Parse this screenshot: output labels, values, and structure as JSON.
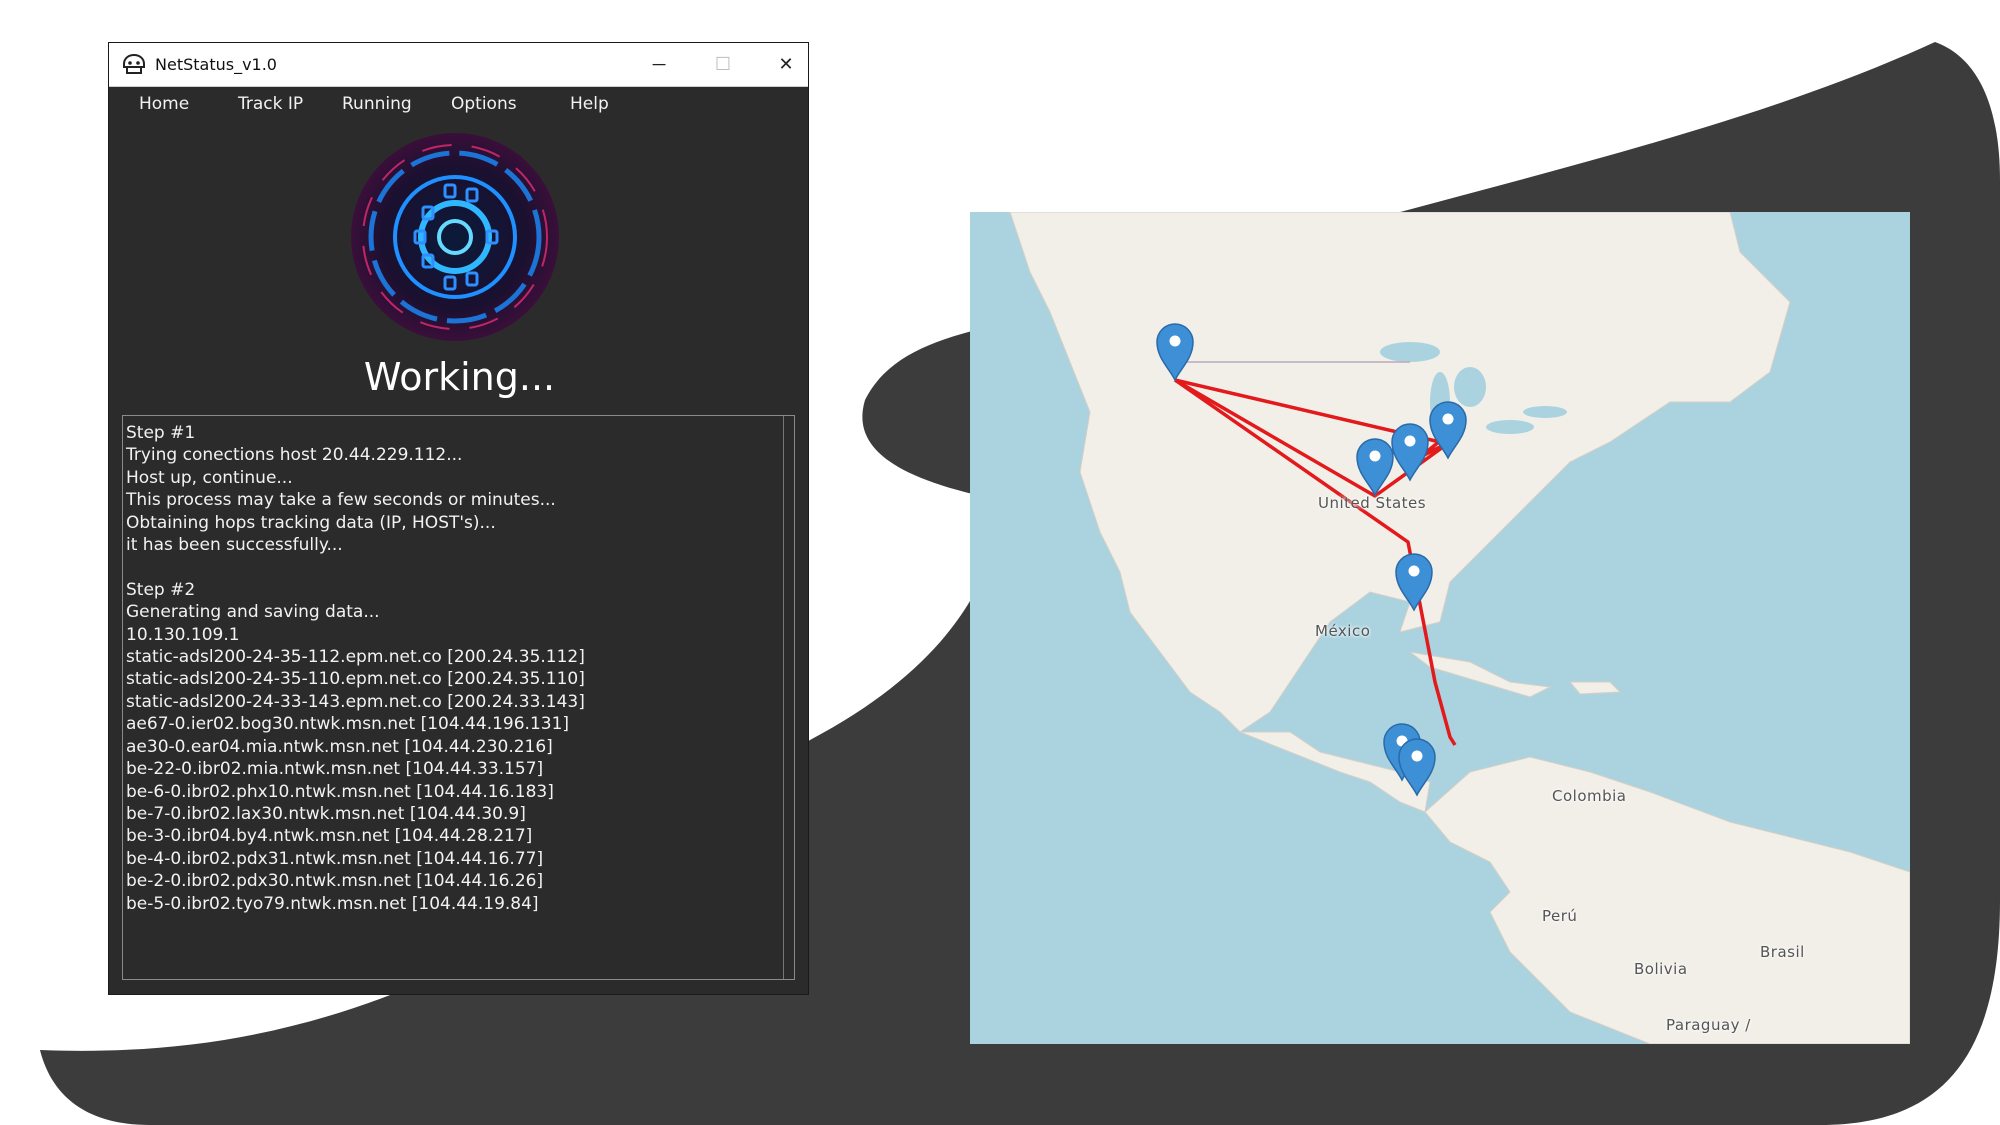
{
  "window": {
    "title": "NetStatus_v1.0",
    "minimize_glyph": "─",
    "maximize_glyph": "☐",
    "close_glyph": "✕"
  },
  "menu": [
    "Home",
    "Track IP",
    "Running",
    "Options",
    "Help"
  ],
  "status_text": "Working...",
  "log": {
    "step1": {
      "title": "Step #1",
      "lines": [
        "Trying conections host 20.44.229.112...",
        "Host up, continue...",
        "This process may take a few seconds or minutes...",
        "Obtaining hops tracking data (IP, HOST's)...",
        "it has been successfully..."
      ]
    },
    "step2": {
      "title": "Step #2",
      "lines": [
        "Generating and saving data...",
        "10.130.109.1",
        "static-adsl200-24-35-112.epm.net.co [200.24.35.112]",
        "static-adsl200-24-35-110.epm.net.co [200.24.35.110]",
        "static-adsl200-24-33-143.epm.net.co [200.24.33.143]",
        "ae67-0.ier02.bog30.ntwk.msn.net [104.44.196.131]",
        "ae30-0.ear04.mia.ntwk.msn.net [104.44.230.216]",
        "be-22-0.ibr02.mia.ntwk.msn.net [104.44.33.157]",
        "be-6-0.ibr02.phx10.ntwk.msn.net [104.44.16.183]",
        "be-7-0.ibr02.lax30.ntwk.msn.net [104.44.30.9]",
        "be-3-0.ibr04.by4.ntwk.msn.net [104.44.28.217]",
        "be-4-0.ibr02.pdx31.ntwk.msn.net [104.44.16.77]",
        "be-2-0.ibr02.pdx30.ntwk.msn.net [104.44.16.26]",
        "be-5-0.ibr02.tyo79.ntwk.msn.net [104.44.19.84]"
      ]
    }
  },
  "map": {
    "labels": [
      "United States",
      "México",
      "Colombia",
      "Perú",
      "Bolivia",
      "Brasil",
      "Paraguay /"
    ],
    "route_color": "#e31a1c",
    "marker_color": "#3d8fd6",
    "water_color": "#aad3df",
    "land_color": "#f2efe9"
  },
  "colors": {
    "window_bg": "#2b2b2b",
    "backdrop_shape": "#3d3d3d"
  }
}
